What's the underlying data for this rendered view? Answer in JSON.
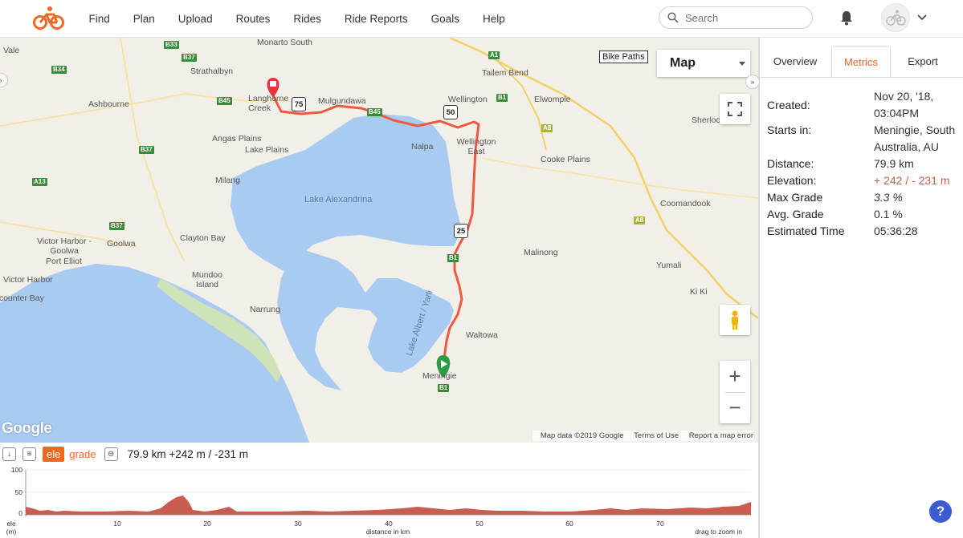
{
  "nav": {
    "items": [
      "Find",
      "Plan",
      "Upload",
      "Routes",
      "Rides",
      "Ride Reports",
      "Goals",
      "Help"
    ],
    "search_placeholder": "Search"
  },
  "colors": {
    "accent": "#f26722",
    "route": "#f0593e",
    "water": "#a9cbf2",
    "elevation_fill": "#cd5c50",
    "start_marker": "#2e9b48",
    "end_marker": "#e8323e"
  },
  "map": {
    "type_select": "Map",
    "bike_paths_label": "Bike Paths",
    "google_label": "Google",
    "attribution": [
      "Map data ©2019 Google",
      "Terms of Use",
      "Report a map error"
    ],
    "places": [
      {
        "label": "Vale"
      },
      {
        "label": "Monarto South"
      },
      {
        "label": "Strathalbyn"
      },
      {
        "label": "Langhorne Creek"
      },
      {
        "label": "Mulgundawa"
      },
      {
        "label": "Wellington"
      },
      {
        "label": "Tailem Bend"
      },
      {
        "label": "Elwomple"
      },
      {
        "label": "Ashbourne"
      },
      {
        "label": "Sherlock"
      },
      {
        "label": "Angas Plains"
      },
      {
        "label": "Lake Plains"
      },
      {
        "label": "Nalpa"
      },
      {
        "label": "Wellington East"
      },
      {
        "label": "Cooke Plains"
      },
      {
        "label": "Milang"
      },
      {
        "label": "Lake Alexandrina"
      },
      {
        "label": "Coomandook"
      },
      {
        "label": "Victor Harbor - Goolwa"
      },
      {
        "label": "Goolwa"
      },
      {
        "label": "Clayton Bay"
      },
      {
        "label": "Port Elliot"
      },
      {
        "label": "Malinong"
      },
      {
        "label": "Yumali"
      },
      {
        "label": "Victor Harbor"
      },
      {
        "label": "Mundoo Island"
      },
      {
        "label": "Encounter Bay"
      },
      {
        "label": "Ki Ki"
      },
      {
        "label": "Narrung"
      },
      {
        "label": "Lake Albert / Yarli"
      },
      {
        "label": "Waltowa"
      },
      {
        "label": "Meningie"
      }
    ],
    "highway_shields": [
      "75",
      "50",
      "25"
    ],
    "route_badges": [
      "B33",
      "B37",
      "B34",
      "B45",
      "A1",
      "B1",
      "A8",
      "B37",
      "A13",
      "B37",
      "B1",
      "A8",
      "B45",
      "B1"
    ]
  },
  "elevation": {
    "ele_label": "ele",
    "grade_label": "grade",
    "summary": "79.9 km +242 m / -231 m",
    "y_ticks": [
      "100",
      "50",
      "0"
    ],
    "x_ticks": [
      "10",
      "20",
      "30",
      "40",
      "50",
      "60",
      "70"
    ],
    "y_axis_label": "ele",
    "y_axis_unit": "(m)",
    "x_axis_label": "distance in km",
    "hint": "drag to zoom in"
  },
  "sidebar": {
    "tabs": [
      "Overview",
      "Metrics",
      "Export"
    ],
    "active_tab": "Metrics",
    "metrics": [
      {
        "key": "Created:",
        "value": "Nov 20, '18, 03:04PM"
      },
      {
        "key": "Starts in:",
        "value": "Meningie, South Australia, AU"
      },
      {
        "key": "Distance:",
        "value": "79.9 km"
      },
      {
        "key": "Elevation:",
        "value": "+ 242 / - 231 m"
      },
      {
        "key": "Max Grade",
        "value": "3.3 %"
      },
      {
        "key": "Avg. Grade",
        "value": "0.1 %"
      },
      {
        "key": "Estimated Time",
        "value": "05:36:28"
      }
    ]
  }
}
